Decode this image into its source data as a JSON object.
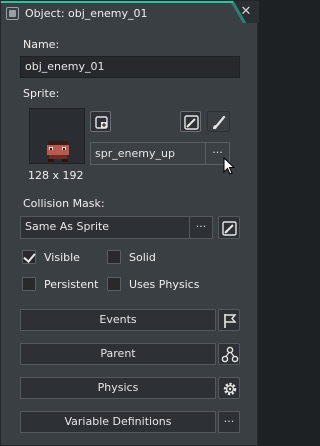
{
  "window": {
    "title": "Object: obj_enemy_01",
    "close_glyph": "✕"
  },
  "name_section": {
    "label": "Name:",
    "value": "obj_enemy_01"
  },
  "sprite_section": {
    "label": "Sprite:",
    "sprite_name": "spr_enemy_up",
    "dimensions": "128 x 192",
    "browse_glyph": "···"
  },
  "collision": {
    "label": "Collision Mask:",
    "value": "Same As Sprite",
    "browse_glyph": "···"
  },
  "checkboxes": [
    {
      "label": "Visible",
      "checked": true
    },
    {
      "label": "Solid",
      "checked": false
    },
    {
      "label": "Persistent",
      "checked": false
    },
    {
      "label": "Uses Physics",
      "checked": false
    }
  ],
  "buttons": [
    {
      "label": "Events",
      "icon": "flag-icon"
    },
    {
      "label": "Parent",
      "icon": "hierarchy-icon"
    },
    {
      "label": "Physics",
      "icon": "gear-icon"
    },
    {
      "label": "Variable Definitions",
      "icon": "ellipsis-icon"
    }
  ],
  "colors": {
    "accent": "#2bc4a0",
    "panel": "#3a3f44",
    "field": "#27292c"
  }
}
